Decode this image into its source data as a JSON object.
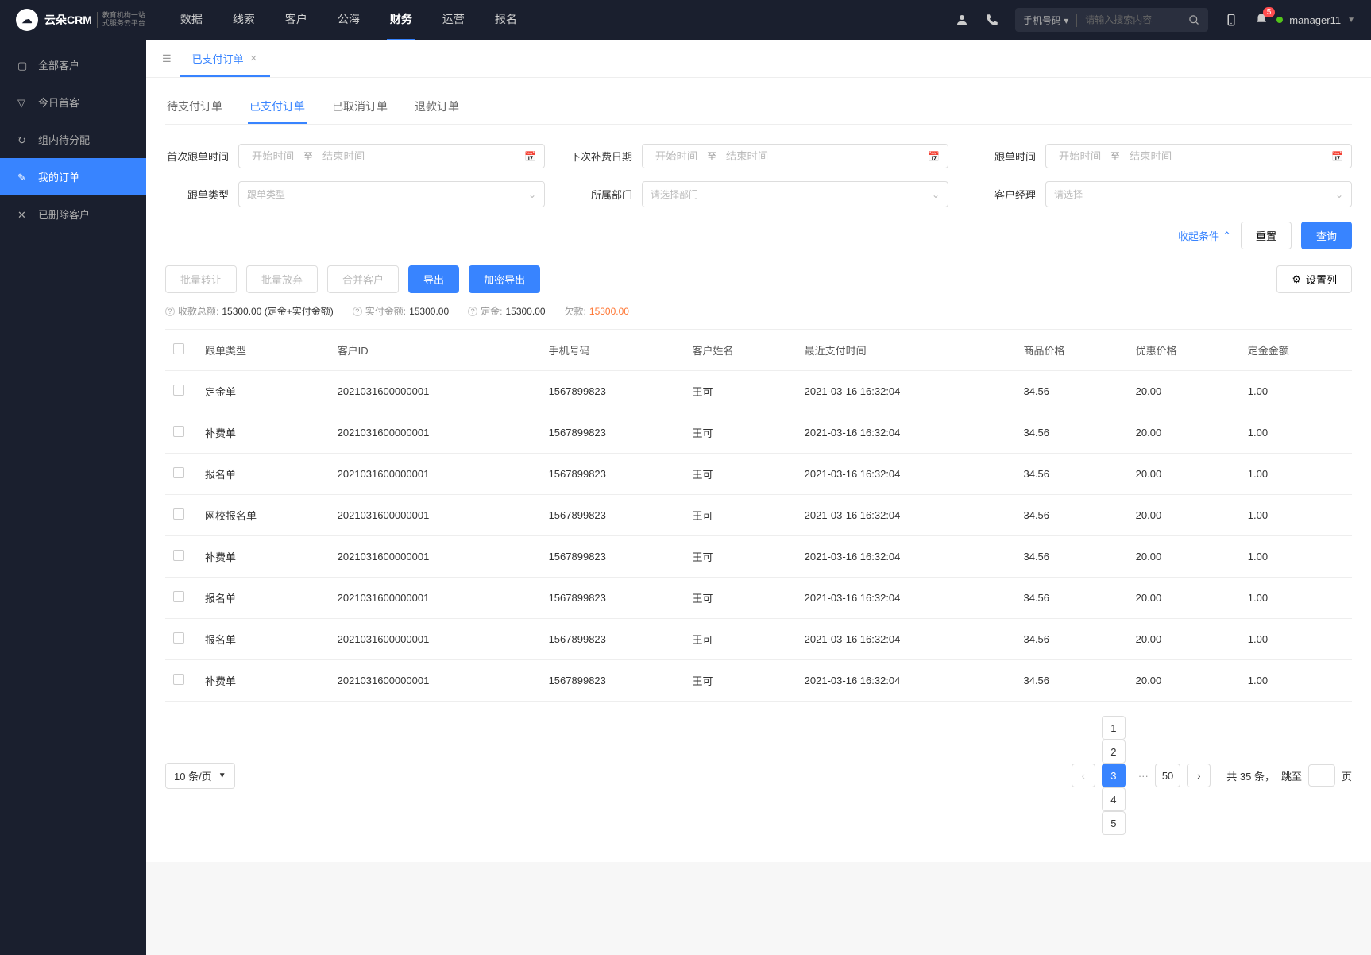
{
  "header": {
    "logo_text": "云朵CRM",
    "logo_sub1": "教育机构一站",
    "logo_sub2": "式服务云平台",
    "nav": [
      "数据",
      "线索",
      "客户",
      "公海",
      "财务",
      "运营",
      "报名"
    ],
    "nav_active_index": 4,
    "search_type": "手机号码",
    "search_placeholder": "请输入搜索内容",
    "notif_count": "5",
    "user_name": "manager11"
  },
  "sidebar": {
    "items": [
      {
        "label": "全部客户"
      },
      {
        "label": "今日首客"
      },
      {
        "label": "组内待分配"
      },
      {
        "label": "我的订单"
      },
      {
        "label": "已删除客户"
      }
    ],
    "active_index": 3
  },
  "page_tabs": [
    {
      "label": "已支付订单",
      "active": true
    }
  ],
  "sub_tabs": {
    "items": [
      "待支付订单",
      "已支付订单",
      "已取消订单",
      "退款订单"
    ],
    "active_index": 1
  },
  "filters": {
    "first_follow_label": "首次跟单时间",
    "next_fee_label": "下次补费日期",
    "follow_time_label": "跟单时间",
    "follow_type_label": "跟单类型",
    "follow_type_placeholder": "跟单类型",
    "department_label": "所属部门",
    "department_placeholder": "请选择部门",
    "manager_label": "客户经理",
    "manager_placeholder": "请选择",
    "start_placeholder": "开始时间",
    "end_placeholder": "结束时间",
    "to_text": "至",
    "collapse_text": "收起条件",
    "reset": "重置",
    "search": "查询"
  },
  "actions": {
    "batch_transfer": "批量转让",
    "batch_abandon": "批量放弃",
    "merge": "合并客户",
    "export": "导出",
    "encrypt_export": "加密导出",
    "columns": "设置列"
  },
  "summary": {
    "total_receive_label": "收款总额:",
    "total_receive_value": "15300.00 (定金+实付金额)",
    "paid_label": "实付金额:",
    "paid_value": "15300.00",
    "deposit_label": "定金:",
    "deposit_value": "15300.00",
    "owed_label": "欠款:",
    "owed_value": "15300.00"
  },
  "table": {
    "headers": [
      "跟单类型",
      "客户ID",
      "手机号码",
      "客户姓名",
      "最近支付时间",
      "商品价格",
      "优惠价格",
      "定金金额"
    ],
    "rows": [
      {
        "type": "定金单",
        "id": "2021031600000001",
        "phone": "1567899823",
        "name": "王可",
        "time": "2021-03-16 16:32:04",
        "price": "34.56",
        "discount": "20.00",
        "deposit": "1.00"
      },
      {
        "type": "补费单",
        "id": "2021031600000001",
        "phone": "1567899823",
        "name": "王可",
        "time": "2021-03-16 16:32:04",
        "price": "34.56",
        "discount": "20.00",
        "deposit": "1.00"
      },
      {
        "type": "报名单",
        "id": "2021031600000001",
        "phone": "1567899823",
        "name": "王可",
        "time": "2021-03-16 16:32:04",
        "price": "34.56",
        "discount": "20.00",
        "deposit": "1.00"
      },
      {
        "type": "网校报名单",
        "id": "2021031600000001",
        "phone": "1567899823",
        "name": "王可",
        "time": "2021-03-16 16:32:04",
        "price": "34.56",
        "discount": "20.00",
        "deposit": "1.00"
      },
      {
        "type": "补费单",
        "id": "2021031600000001",
        "phone": "1567899823",
        "name": "王可",
        "time": "2021-03-16 16:32:04",
        "price": "34.56",
        "discount": "20.00",
        "deposit": "1.00"
      },
      {
        "type": "报名单",
        "id": "2021031600000001",
        "phone": "1567899823",
        "name": "王可",
        "time": "2021-03-16 16:32:04",
        "price": "34.56",
        "discount": "20.00",
        "deposit": "1.00"
      },
      {
        "type": "报名单",
        "id": "2021031600000001",
        "phone": "1567899823",
        "name": "王可",
        "time": "2021-03-16 16:32:04",
        "price": "34.56",
        "discount": "20.00",
        "deposit": "1.00"
      },
      {
        "type": "补费单",
        "id": "2021031600000001",
        "phone": "1567899823",
        "name": "王可",
        "time": "2021-03-16 16:32:04",
        "price": "34.56",
        "discount": "20.00",
        "deposit": "1.00"
      }
    ]
  },
  "pagination": {
    "page_size_label": "10 条/页",
    "pages": [
      "1",
      "2",
      "3",
      "4",
      "5"
    ],
    "current": "3",
    "last": "50",
    "total_text": "共 35 条，",
    "jump_text": "跳至",
    "page_suffix": "页"
  }
}
